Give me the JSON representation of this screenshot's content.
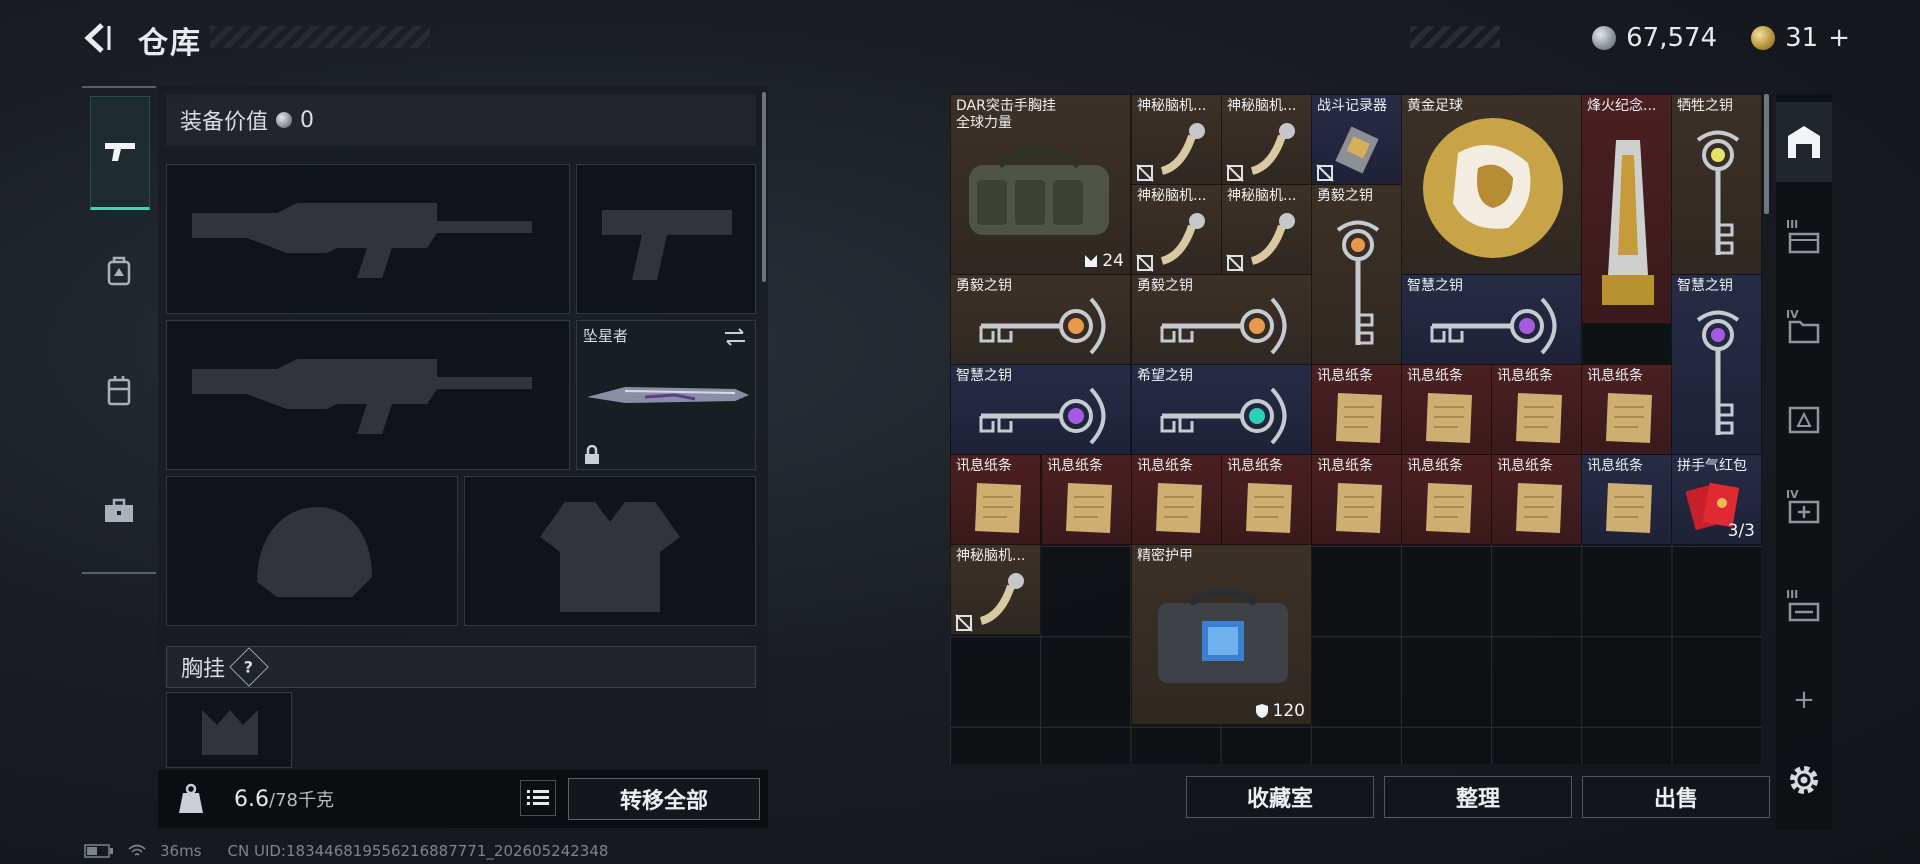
{
  "header": {
    "title": "仓库",
    "currency_silver": "67,574",
    "currency_gold": "31",
    "currency_gold_add": "+"
  },
  "equipment": {
    "value_label": "装备价值",
    "value": "0",
    "melee_name": "坠星者",
    "chest_label": "胸挂",
    "chest_help": "?",
    "weight_current": "6.6",
    "weight_max": "/78千克",
    "transfer_all": "转移全部"
  },
  "status": {
    "ping": "36ms",
    "uid": "CN UID:1834468195562168877​71_202605242348"
  },
  "inventory": {
    "items": [
      {
        "name": "DAR突击手胸挂",
        "sub": "全球力量",
        "badge": "24"
      },
      {
        "name": "神秘脑机..."
      },
      {
        "name": "神秘脑机..."
      },
      {
        "name": "战斗记录器"
      },
      {
        "name": "黄金足球"
      },
      {
        "name": "烽火纪念..."
      },
      {
        "name": "牺牲之钥"
      },
      {
        "name": "神秘脑机..."
      },
      {
        "name": "神秘脑机..."
      },
      {
        "name": "勇毅之钥"
      },
      {
        "name": "勇毅之钥"
      },
      {
        "name": "勇毅之钥"
      },
      {
        "name": "智慧之钥"
      },
      {
        "name": "智慧之钥"
      },
      {
        "name": "智慧之钥"
      },
      {
        "name": "希望之钥"
      },
      {
        "name": "讯息纸条"
      },
      {
        "name": "讯息纸条"
      },
      {
        "name": "讯息纸条"
      },
      {
        "name": "讯息纸条"
      },
      {
        "name": "讯息纸条"
      },
      {
        "name": "讯息纸条"
      },
      {
        "name": "讯息纸条"
      },
      {
        "name": "讯息纸条"
      },
      {
        "name": "讯息纸条"
      },
      {
        "name": "讯息纸条"
      },
      {
        "name": "讯息纸条"
      },
      {
        "name": "讯息纸条"
      },
      {
        "name": "拼手气红包",
        "badge": "3/3"
      },
      {
        "name": "神秘脑机..."
      },
      {
        "name": "精密护甲",
        "badge": "120"
      }
    ]
  },
  "actions": {
    "collection": "收藏室",
    "organize": "整理",
    "sell": "出售"
  },
  "side_tabs": [
    "III",
    "IV",
    "IV",
    "III",
    "+"
  ],
  "colors": {
    "accent": "#3fd4b0",
    "item_brown": "#3c3128",
    "item_red": "#4a2022",
    "item_purple": "#272b45"
  }
}
